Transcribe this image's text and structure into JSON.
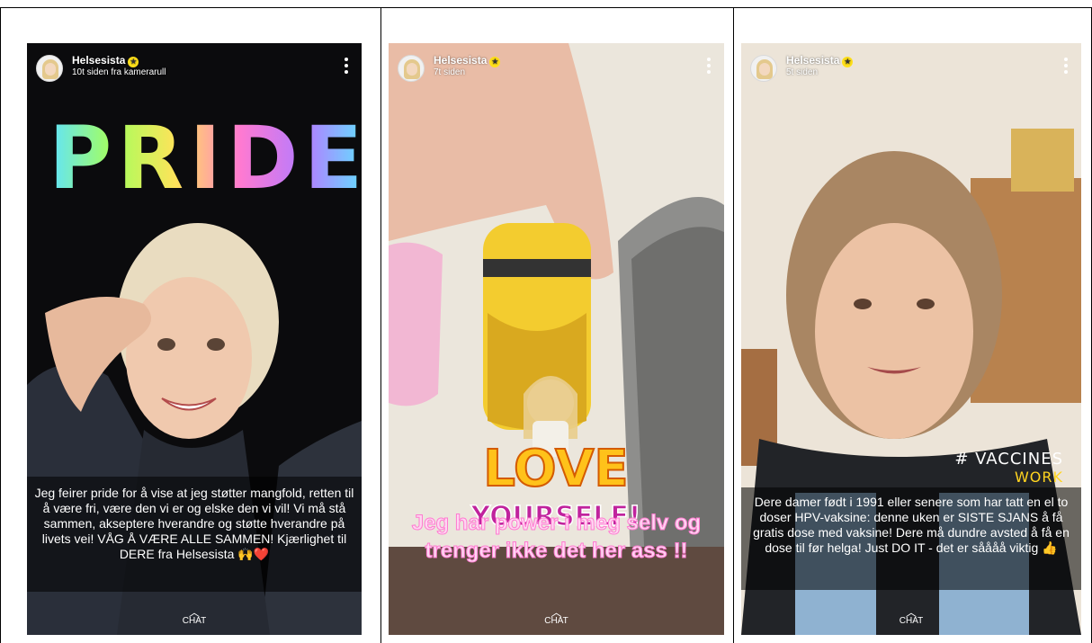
{
  "stories": [
    {
      "username": "Helsesista",
      "timestamp": "10t siden fra kamerarull",
      "sticker": "PRIDE",
      "caption": "Jeg feirer pride for å vise at jeg støtter mangfold, retten til å være fri, være den vi er og elske den vi vil! Vi må stå sammen, akseptere hverandre og støtte hverandre på livets vei! VÅG Å VÆRE ALLE SAMMEN! Kjærlighet til DERE fra Helsesista 🙌❤️",
      "chat_label": "CHAT"
    },
    {
      "username": "Helsesista",
      "timestamp": "7t siden",
      "sticker_love": "LOVE",
      "sticker_yourself": "YOURSELF!",
      "caption": "Jeg har power i meg selv og trenger ikke det her ass !!",
      "chat_label": "CHAT"
    },
    {
      "username": "Helsesista",
      "timestamp": "5t siden",
      "sticker_line1": "# VACCINES",
      "sticker_line2": "WORK",
      "caption": "Dere damer født i 1991 eller senere som har tatt en el to doser HPV-vaksine: denne uken er SISTE SJANS å få gratis dose med vaksine! Dere må dundre avsted å få en dose til før helga! Just DO IT - det er såååå viktig 👍",
      "chat_label": "CHAT"
    }
  ],
  "colors": {
    "verified_badge": "#ffe01a",
    "caption_overlay": "rgba(0,0,0,0.55)",
    "pink_text": "#ffd6f2"
  }
}
